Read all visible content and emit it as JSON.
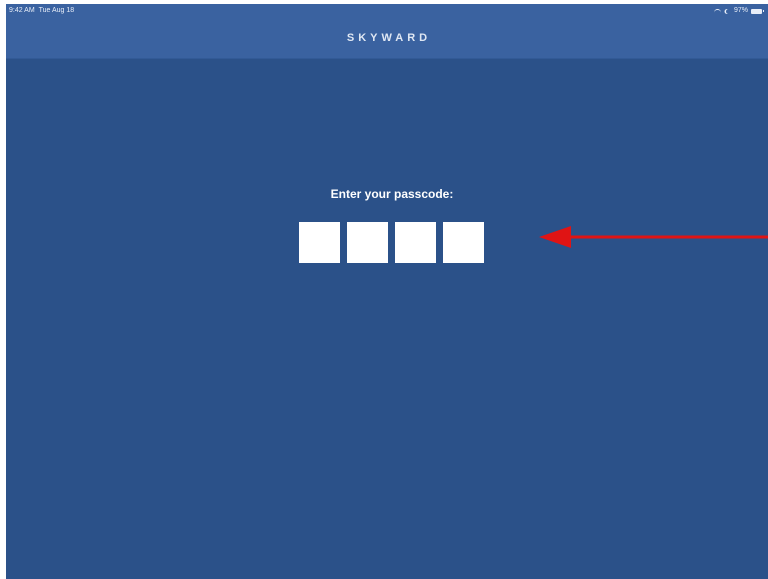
{
  "status_bar": {
    "time": "9:42 AM",
    "date": "Tue Aug 18",
    "battery": "97%"
  },
  "nav": {
    "brand": "SKYWARD"
  },
  "main": {
    "prompt": "Enter your passcode:",
    "passcode_digits": [
      "",
      "",
      "",
      ""
    ]
  },
  "icons": {
    "wifi": "wifi-icon",
    "moon": "moon-icon",
    "battery": "battery-icon",
    "arrow": "red-arrow-annotation"
  },
  "colors": {
    "background": "#2b5189",
    "nav_bar": "#3a62a0",
    "arrow": "#e01414"
  }
}
